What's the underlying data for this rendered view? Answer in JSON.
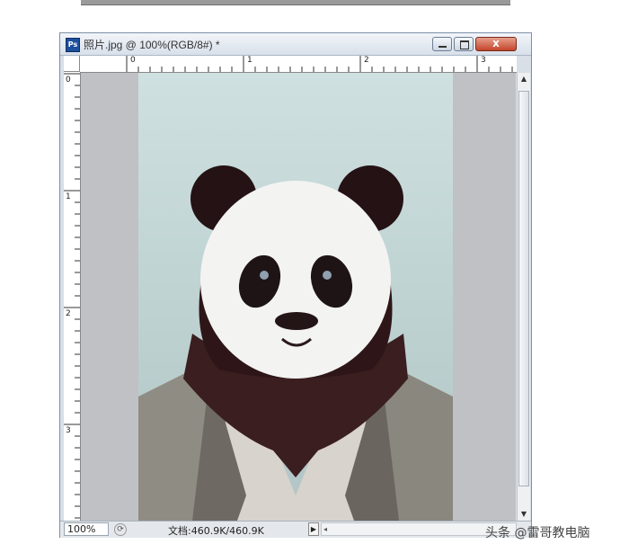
{
  "window": {
    "title": "照片.jpg @ 100%(RGB/8#) *",
    "app_icon": "Ps",
    "close_symbol": "x"
  },
  "ruler": {
    "horizontal_labels": [
      "0",
      "1",
      "2",
      "3"
    ],
    "vertical_labels": [
      "0",
      "1",
      "2",
      "3"
    ]
  },
  "status": {
    "zoom": "100%",
    "doc_info": "文档:460.9K/460.9K",
    "arrow": "▶"
  },
  "watermark": "头条 @雷哥教电脑",
  "icons": {
    "app": "photoshop-icon",
    "minimize": "minimize-icon",
    "maximize": "maximize-icon",
    "close": "close-icon"
  }
}
